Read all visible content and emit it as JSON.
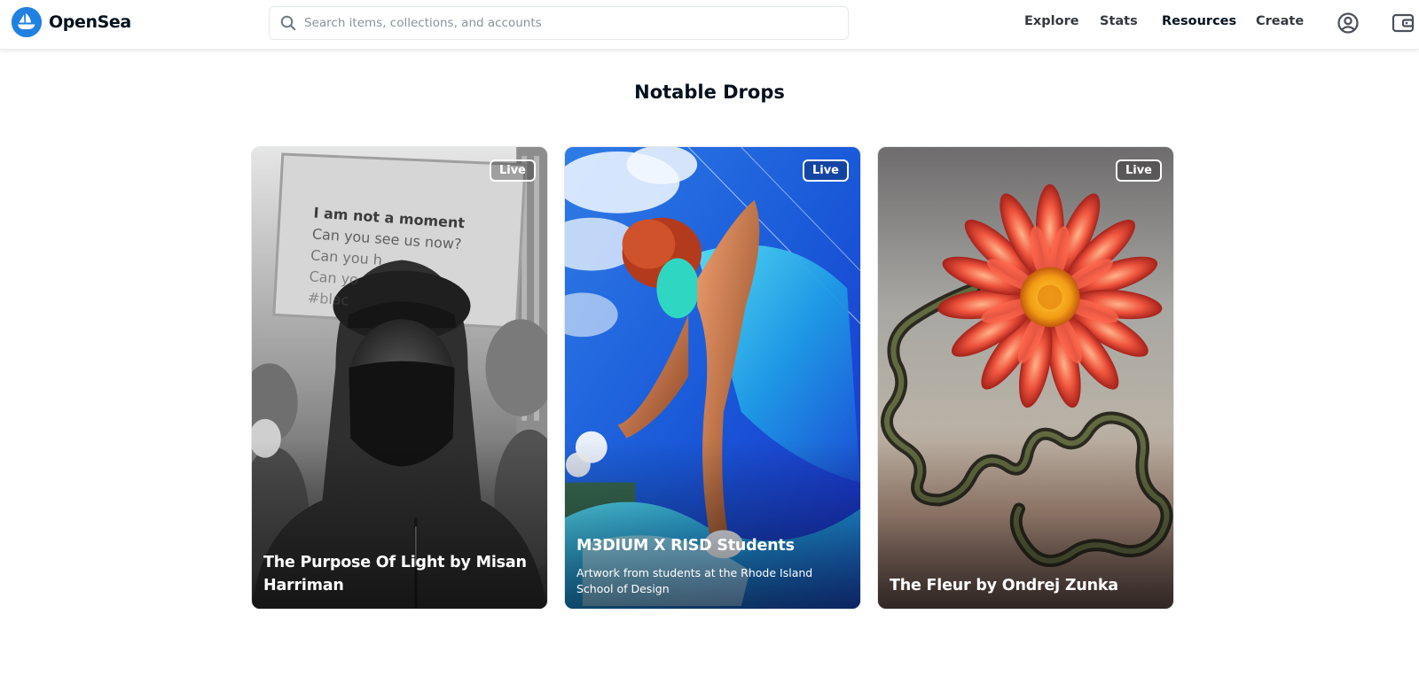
{
  "header": {
    "brand": "OpenSea",
    "search_placeholder": "Search items, collections, and accounts",
    "nav": {
      "explore": "Explore",
      "stats": "Stats",
      "resources": "Resources",
      "create": "Create"
    },
    "icons": {
      "logo": "opensea-logo-icon",
      "search": "search-icon",
      "account": "account-icon",
      "wallet": "wallet-icon"
    }
  },
  "main": {
    "section_title": "Notable Drops",
    "cards": [
      {
        "badge": "Live",
        "title": "The Purpose Of Light by Misan Harriman",
        "subtitle": "",
        "sign_text": [
          "I am not a moment",
          "Can you see us now?",
          "Can you h",
          "Can yo",
          "#blac"
        ]
      },
      {
        "badge": "Live",
        "title": "M3DIUM X RISD Students",
        "subtitle": "Artwork from students at the Rhode Island School of Design"
      },
      {
        "badge": "Live",
        "title": "The Fleur by Ondrej Zunka",
        "subtitle": ""
      }
    ]
  },
  "colors": {
    "brand_blue": "#2081e2",
    "text_primary": "#04111d",
    "text_secondary": "#353840",
    "placeholder": "#8a939b"
  }
}
